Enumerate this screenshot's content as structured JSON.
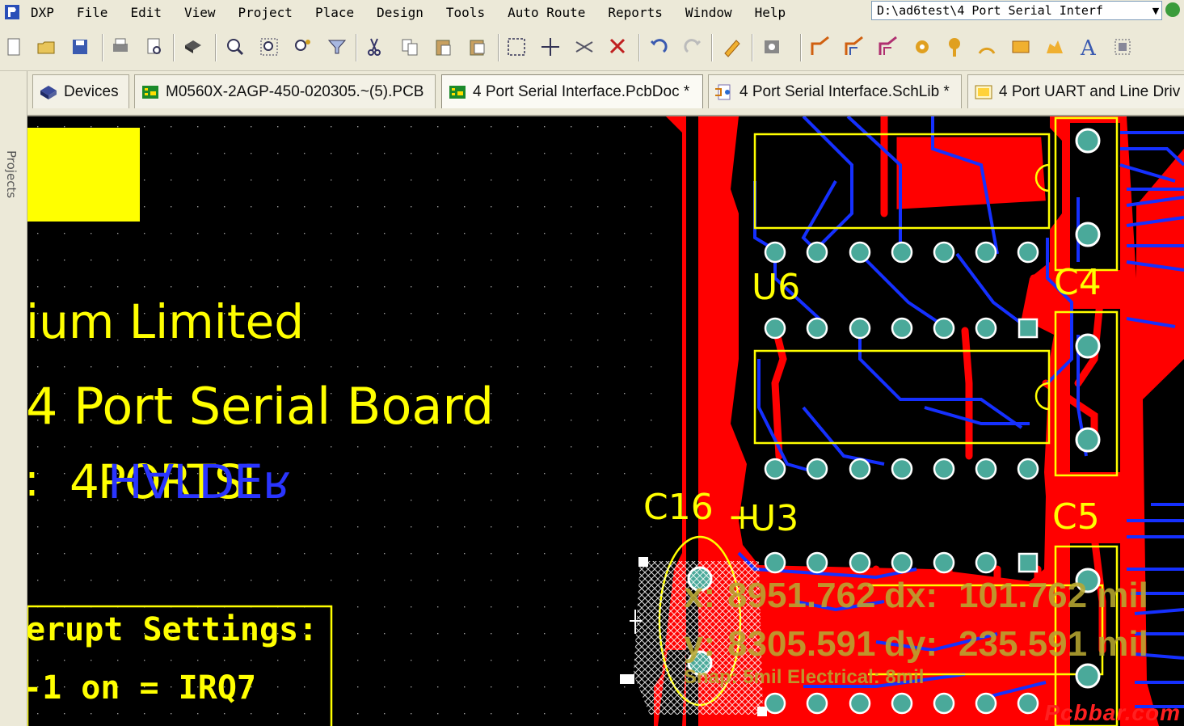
{
  "menu": {
    "items": [
      "DXP",
      "File",
      "Edit",
      "View",
      "Project",
      "Place",
      "Design",
      "Tools",
      "Auto Route",
      "Reports",
      "Window",
      "Help"
    ]
  },
  "path_bar": {
    "value": "D:\\ad6test\\4 Port Serial Interf"
  },
  "toolbar": {
    "icons": [
      "new-icon",
      "open-icon",
      "save-icon",
      "print-icon",
      "print-preview-icon",
      "component-icon",
      "zoom-fit-icon",
      "zoom-area-icon",
      "zoom-selected-icon",
      "filter-icon",
      "cut-icon",
      "copy-icon",
      "paste-icon",
      "rubber-stamp-icon",
      "select-area-icon",
      "move-icon",
      "cross-probe-icon",
      "clear-icon",
      "undo-icon",
      "redo-icon",
      "highlight-icon",
      "browse-icon",
      "route-icon",
      "route-diff-icon",
      "route-multi-icon",
      "via-icon",
      "pad-icon",
      "arc-icon",
      "fill-icon",
      "polygon-icon",
      "string-icon",
      "array-icon"
    ]
  },
  "sidebar": {
    "label": "Projects"
  },
  "tabs": [
    {
      "label": "Devices",
      "icon": "devices-icon",
      "active": false
    },
    {
      "label": "M0560X-2AGP-450-020305.~(5).PCB",
      "icon": "pcb-doc-icon",
      "active": false
    },
    {
      "label": "4 Port Serial Interface.PcbDoc *",
      "icon": "pcb-doc-icon",
      "active": true
    },
    {
      "label": "4 Port Serial Interface.SchLib *",
      "icon": "schlib-icon",
      "active": false
    },
    {
      "label": "4 Port UART and Line Driv",
      "icon": "sch-doc-icon",
      "active": false
    }
  ],
  "pcb": {
    "silkscreen": {
      "company": "ium Limited",
      "board_title": "4 Port Serial Board",
      "part_prefix": ":",
      "part_number": "4PORTSI",
      "mirrored_text": "ᴚƎᗡ⅃ⱯH",
      "interrupt_title": "erupt Settings:",
      "interrupt_line": "-1 on = IRQ7",
      "designators": {
        "u6": "U6",
        "u3": "U3",
        "c16": "C16",
        "c4": "C4",
        "c5": "C5"
      }
    },
    "cursor_readout": {
      "x_label": "x:",
      "x_value": "8951.762",
      "dx_label": "dx:",
      "dx_value": "101.762 mil",
      "y_label": "y:",
      "y_value": "8305.591",
      "dy_label": "dy:",
      "dy_value": "235.591 mil",
      "snap_text": "Snap: 5mil Electrical: 8mil"
    },
    "colors": {
      "background": "#000000",
      "top_layer": "#ff0000",
      "bottom_layer": "#0020ff",
      "silkscreen": "#ffff00",
      "pad": "#4aa99a"
    }
  },
  "watermark": "Pcbbar.com"
}
